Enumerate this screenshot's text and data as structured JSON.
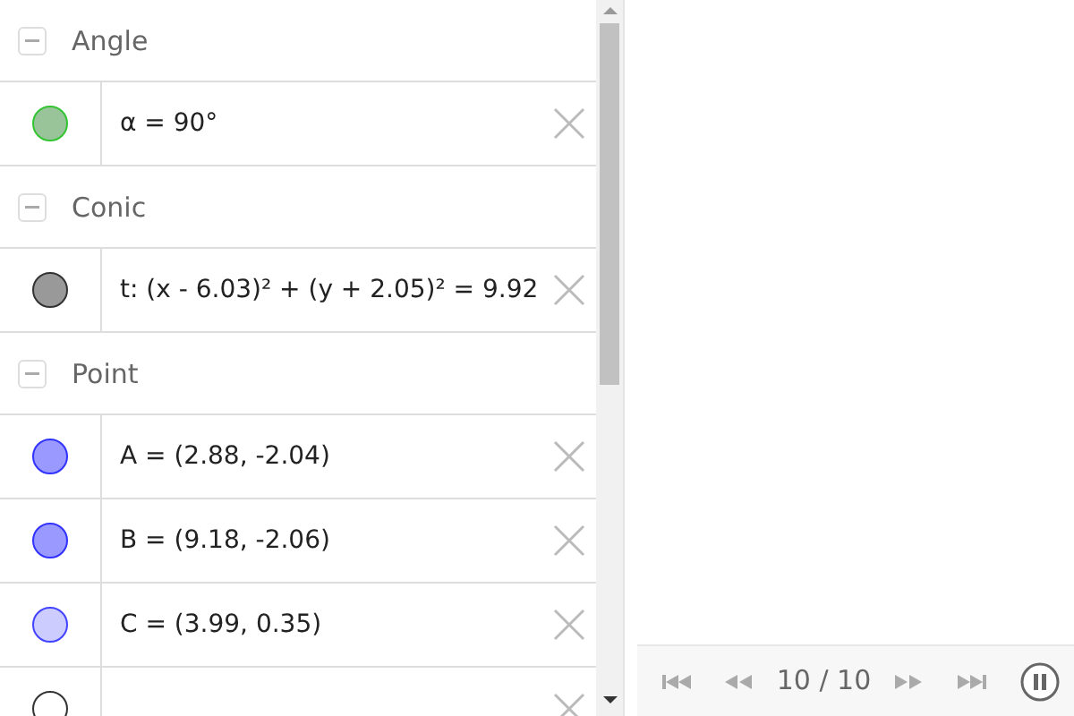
{
  "groups": [
    {
      "title": "Angle",
      "expanded": true,
      "items": [
        {
          "formula": "α = 90°",
          "color": "#99c499"
        }
      ]
    },
    {
      "title": "Conic",
      "expanded": true,
      "items": [
        {
          "formula": "t: (x - 6.03)² + (y + 2.05)² = 9.92",
          "color": "#999999"
        }
      ]
    },
    {
      "title": "Point",
      "expanded": true,
      "items": [
        {
          "formula": "A = (2.88, -2.04)",
          "color": "#9999ff"
        },
        {
          "formula": "B = (9.18, -2.06)",
          "color": "#9999ff"
        },
        {
          "formula": "C = (3.99, 0.35)",
          "color": "#ccccff"
        },
        {
          "color": "#ffffff"
        }
      ]
    }
  ],
  "player": {
    "position": "10 / 10",
    "playing": true
  }
}
